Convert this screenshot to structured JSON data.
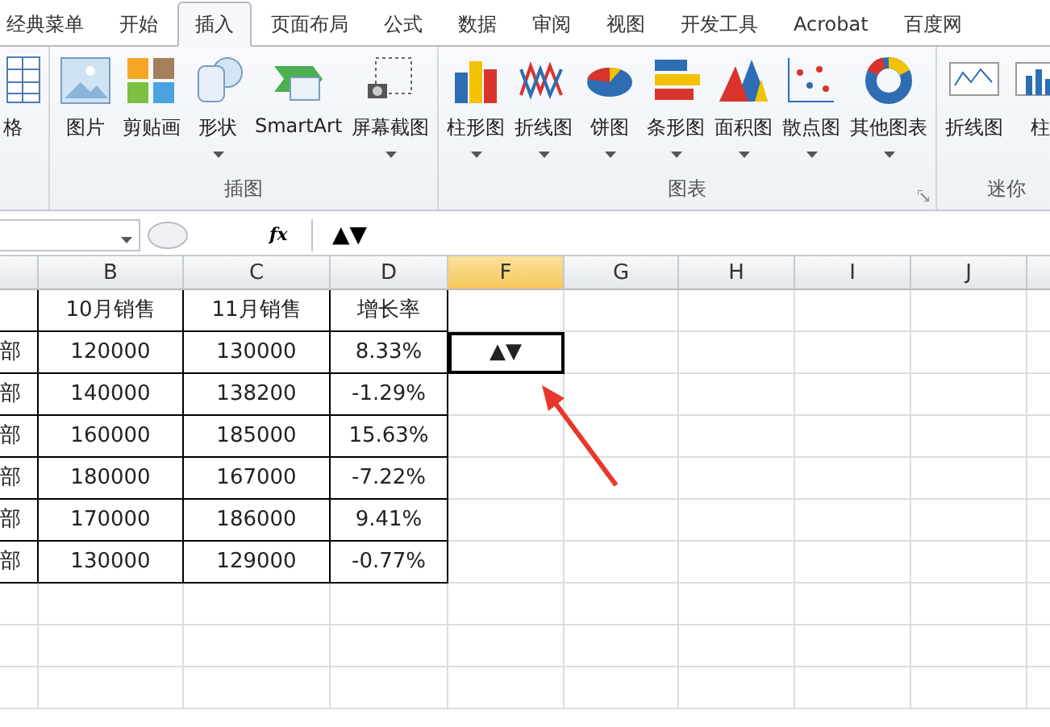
{
  "ribbon_tabs": [
    {
      "label": "经典菜单",
      "selected": false
    },
    {
      "label": "开始",
      "selected": false
    },
    {
      "label": "插入",
      "selected": true
    },
    {
      "label": "页面布局",
      "selected": false
    },
    {
      "label": "公式",
      "selected": false
    },
    {
      "label": "数据",
      "selected": false
    },
    {
      "label": "审阅",
      "selected": false
    },
    {
      "label": "视图",
      "selected": false
    },
    {
      "label": "开发工具",
      "selected": false
    },
    {
      "label": "Acrobat",
      "selected": false
    },
    {
      "label": "百度网",
      "selected": false
    }
  ],
  "ribbon_groups": [
    {
      "items": [
        {
          "label": "格",
          "dropdown": false
        }
      ]
    },
    {
      "title": "插图",
      "items": [
        {
          "label": "图片",
          "dropdown": false
        },
        {
          "label": "剪贴画",
          "dropdown": false
        },
        {
          "label": "形状",
          "dropdown": true
        },
        {
          "label": "SmartArt",
          "dropdown": false
        },
        {
          "label": "屏幕截图",
          "dropdown": true
        }
      ]
    },
    {
      "title": "图表",
      "launcher": true,
      "items": [
        {
          "label": "柱形图",
          "dropdown": true
        },
        {
          "label": "折线图",
          "dropdown": true
        },
        {
          "label": "饼图",
          "dropdown": true
        },
        {
          "label": "条形图",
          "dropdown": true
        },
        {
          "label": "面积图",
          "dropdown": true
        },
        {
          "label": "散点图",
          "dropdown": true
        },
        {
          "label": "其他图表",
          "dropdown": true
        }
      ]
    },
    {
      "title": "迷你",
      "items": [
        {
          "label": "折线图",
          "dropdown": false
        },
        {
          "label": "柱",
          "dropdown": false
        }
      ]
    }
  ],
  "formula_bar": {
    "function_label": "fx",
    "formula": "▲▼"
  },
  "columns": [
    {
      "label": "B",
      "selected": false
    },
    {
      "label": "C",
      "selected": false
    },
    {
      "label": "D",
      "selected": false
    },
    {
      "label": "F",
      "selected": true
    },
    {
      "label": "G",
      "selected": false
    },
    {
      "label": "H",
      "selected": false
    },
    {
      "label": "I",
      "selected": false
    },
    {
      "label": "J",
      "selected": false
    }
  ],
  "table": {
    "headers": [
      "10月销售",
      "11月销售",
      "增长率"
    ],
    "rows": [
      {
        "dept": "部",
        "values": [
          "120000",
          "130000",
          "8.33%"
        ]
      },
      {
        "dept": "部",
        "values": [
          "140000",
          "138200",
          "-1.29%"
        ]
      },
      {
        "dept": "部",
        "values": [
          "160000",
          "185000",
          "15.63%"
        ]
      },
      {
        "dept": "部",
        "values": [
          "180000",
          "167000",
          "-7.22%"
        ]
      },
      {
        "dept": "部",
        "values": [
          "170000",
          "186000",
          "9.41%"
        ]
      },
      {
        "dept": "部",
        "values": [
          "130000",
          "129000",
          "-0.77%"
        ]
      }
    ]
  },
  "active_cell": {
    "value": "▲▼"
  }
}
